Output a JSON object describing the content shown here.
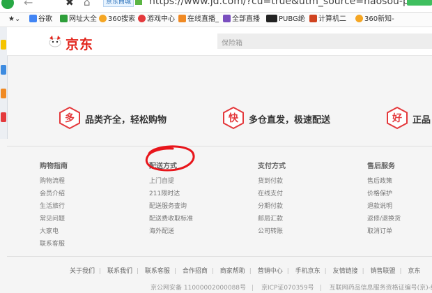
{
  "browser": {
    "addr_tag": "京东商城",
    "url": "https://www.jd.com/?cu=true&utm_source=haosou-pinzhuan",
    "bookmarks": [
      {
        "label": "谷歌",
        "color": "#4285f4"
      },
      {
        "label": "网址大全",
        "color": "#2e9f3a"
      },
      {
        "label": "360搜索",
        "color": "#f5a623"
      },
      {
        "label": "游戏中心",
        "color": "#e4393c"
      },
      {
        "label": "在线直播_",
        "color": "#f08a24"
      },
      {
        "label": "全部直播",
        "color": "#7a4fbf"
      },
      {
        "label": "PUBG绝",
        "color": "#222222"
      },
      {
        "label": "计算机二",
        "color": "#d0431f"
      },
      {
        "label": "360新知-",
        "color": "#f5a623"
      }
    ]
  },
  "jd": {
    "logo_text": "京东",
    "brand_color": "#e2231a",
    "search_placeholder": "保险箱"
  },
  "promises": [
    {
      "char": "多",
      "text": "品类齐全，轻松购物"
    },
    {
      "char": "快",
      "text": "多仓直发，极速配送"
    },
    {
      "char": "好",
      "text": "正品"
    }
  ],
  "footer": {
    "columns": [
      {
        "title": "购物指南",
        "links": [
          "购物流程",
          "会员介绍",
          "生活旅行",
          "常见问题",
          "大家电",
          "联系客服"
        ]
      },
      {
        "title": "配送方式",
        "links": [
          "上门自提",
          "211限时达",
          "配送服务查询",
          "配送费收取标准",
          "海外配送"
        ]
      },
      {
        "title": "支付方式",
        "links": [
          "货到付款",
          "在线支付",
          "分期付款",
          "邮局汇款",
          "公司转账"
        ]
      },
      {
        "title": "售后服务",
        "links": [
          "售后政策",
          "价格保护",
          "退款说明",
          "返修/退换货",
          "取消订单"
        ]
      }
    ],
    "bottom_links": [
      "关于我们",
      "联系我们",
      "联系客服",
      "合作招商",
      "商家帮助",
      "营销中心",
      "手机京东",
      "友情链接",
      "销售联盟",
      "京东"
    ],
    "icp": [
      "京公网安备 11000002000088号",
      "京ICP证070359号",
      "互联网药品信息服务资格证编号(京)-经"
    ]
  },
  "annotation": {
    "color": "#e8151b"
  }
}
